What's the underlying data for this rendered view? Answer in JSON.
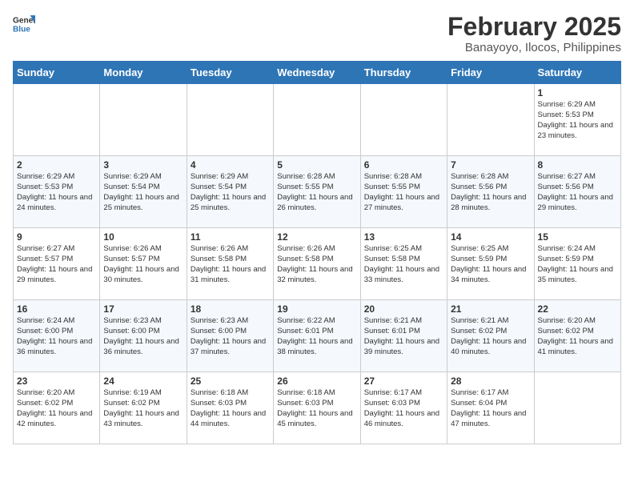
{
  "header": {
    "logo_general": "General",
    "logo_blue": "Blue",
    "title": "February 2025",
    "subtitle": "Banayoyo, Ilocos, Philippines"
  },
  "weekdays": [
    "Sunday",
    "Monday",
    "Tuesday",
    "Wednesday",
    "Thursday",
    "Friday",
    "Saturday"
  ],
  "weeks": [
    [
      {
        "day": "",
        "text": ""
      },
      {
        "day": "",
        "text": ""
      },
      {
        "day": "",
        "text": ""
      },
      {
        "day": "",
        "text": ""
      },
      {
        "day": "",
        "text": ""
      },
      {
        "day": "",
        "text": ""
      },
      {
        "day": "1",
        "text": "Sunrise: 6:29 AM\nSunset: 5:53 PM\nDaylight: 11 hours and 23 minutes."
      }
    ],
    [
      {
        "day": "2",
        "text": "Sunrise: 6:29 AM\nSunset: 5:53 PM\nDaylight: 11 hours and 24 minutes."
      },
      {
        "day": "3",
        "text": "Sunrise: 6:29 AM\nSunset: 5:54 PM\nDaylight: 11 hours and 25 minutes."
      },
      {
        "day": "4",
        "text": "Sunrise: 6:29 AM\nSunset: 5:54 PM\nDaylight: 11 hours and 25 minutes."
      },
      {
        "day": "5",
        "text": "Sunrise: 6:28 AM\nSunset: 5:55 PM\nDaylight: 11 hours and 26 minutes."
      },
      {
        "day": "6",
        "text": "Sunrise: 6:28 AM\nSunset: 5:55 PM\nDaylight: 11 hours and 27 minutes."
      },
      {
        "day": "7",
        "text": "Sunrise: 6:28 AM\nSunset: 5:56 PM\nDaylight: 11 hours and 28 minutes."
      },
      {
        "day": "8",
        "text": "Sunrise: 6:27 AM\nSunset: 5:56 PM\nDaylight: 11 hours and 29 minutes."
      }
    ],
    [
      {
        "day": "9",
        "text": "Sunrise: 6:27 AM\nSunset: 5:57 PM\nDaylight: 11 hours and 29 minutes."
      },
      {
        "day": "10",
        "text": "Sunrise: 6:26 AM\nSunset: 5:57 PM\nDaylight: 11 hours and 30 minutes."
      },
      {
        "day": "11",
        "text": "Sunrise: 6:26 AM\nSunset: 5:58 PM\nDaylight: 11 hours and 31 minutes."
      },
      {
        "day": "12",
        "text": "Sunrise: 6:26 AM\nSunset: 5:58 PM\nDaylight: 11 hours and 32 minutes."
      },
      {
        "day": "13",
        "text": "Sunrise: 6:25 AM\nSunset: 5:58 PM\nDaylight: 11 hours and 33 minutes."
      },
      {
        "day": "14",
        "text": "Sunrise: 6:25 AM\nSunset: 5:59 PM\nDaylight: 11 hours and 34 minutes."
      },
      {
        "day": "15",
        "text": "Sunrise: 6:24 AM\nSunset: 5:59 PM\nDaylight: 11 hours and 35 minutes."
      }
    ],
    [
      {
        "day": "16",
        "text": "Sunrise: 6:24 AM\nSunset: 6:00 PM\nDaylight: 11 hours and 36 minutes."
      },
      {
        "day": "17",
        "text": "Sunrise: 6:23 AM\nSunset: 6:00 PM\nDaylight: 11 hours and 36 minutes."
      },
      {
        "day": "18",
        "text": "Sunrise: 6:23 AM\nSunset: 6:00 PM\nDaylight: 11 hours and 37 minutes."
      },
      {
        "day": "19",
        "text": "Sunrise: 6:22 AM\nSunset: 6:01 PM\nDaylight: 11 hours and 38 minutes."
      },
      {
        "day": "20",
        "text": "Sunrise: 6:21 AM\nSunset: 6:01 PM\nDaylight: 11 hours and 39 minutes."
      },
      {
        "day": "21",
        "text": "Sunrise: 6:21 AM\nSunset: 6:02 PM\nDaylight: 11 hours and 40 minutes."
      },
      {
        "day": "22",
        "text": "Sunrise: 6:20 AM\nSunset: 6:02 PM\nDaylight: 11 hours and 41 minutes."
      }
    ],
    [
      {
        "day": "23",
        "text": "Sunrise: 6:20 AM\nSunset: 6:02 PM\nDaylight: 11 hours and 42 minutes."
      },
      {
        "day": "24",
        "text": "Sunrise: 6:19 AM\nSunset: 6:02 PM\nDaylight: 11 hours and 43 minutes."
      },
      {
        "day": "25",
        "text": "Sunrise: 6:18 AM\nSunset: 6:03 PM\nDaylight: 11 hours and 44 minutes."
      },
      {
        "day": "26",
        "text": "Sunrise: 6:18 AM\nSunset: 6:03 PM\nDaylight: 11 hours and 45 minutes."
      },
      {
        "day": "27",
        "text": "Sunrise: 6:17 AM\nSunset: 6:03 PM\nDaylight: 11 hours and 46 minutes."
      },
      {
        "day": "28",
        "text": "Sunrise: 6:17 AM\nSunset: 6:04 PM\nDaylight: 11 hours and 47 minutes."
      },
      {
        "day": "",
        "text": ""
      }
    ]
  ]
}
